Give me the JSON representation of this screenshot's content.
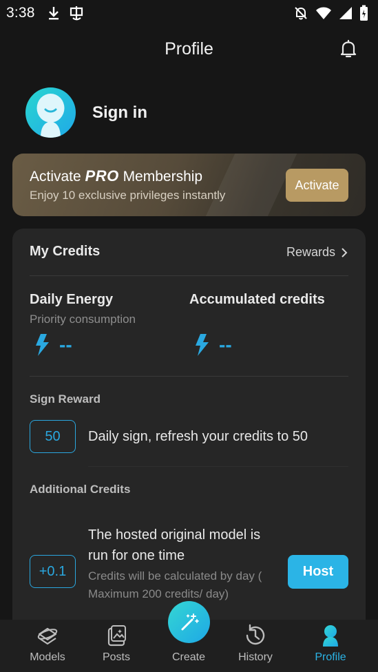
{
  "status_bar": {
    "time": "3:38",
    "icons": [
      "download-icon",
      "app-notification-icon",
      "bell-off-icon",
      "wifi-icon",
      "signal-icon",
      "battery-icon"
    ]
  },
  "header": {
    "title": "Profile"
  },
  "profile": {
    "signin_label": "Sign in"
  },
  "pro_banner": {
    "title_prefix": "Activate ",
    "title_pro": "PRO",
    "title_suffix": " Membership",
    "subtitle": "Enjoy 10 exclusive privileges instantly",
    "button_label": "Activate"
  },
  "credits": {
    "title": "My Credits",
    "rewards_label": "Rewards",
    "daily_energy": {
      "title": "Daily Energy",
      "subtitle": "Priority consumption",
      "value": "--"
    },
    "accumulated": {
      "title": "Accumulated credits",
      "value": "--"
    },
    "sign_reward": {
      "label": "Sign Reward",
      "badge": "50",
      "description": "Daily sign, refresh your credits to 50"
    },
    "additional": {
      "label": "Additional Credits",
      "badge": "+0.1",
      "title": "The hosted original model is run for one time",
      "description": "Credits will be calculated by day ( Maximum 200 credits/ day)",
      "button_label": "Host"
    }
  },
  "bottom_nav": {
    "items": [
      {
        "label": "Models",
        "icon": "models-icon"
      },
      {
        "label": "Posts",
        "icon": "posts-icon"
      },
      {
        "label": "Create",
        "icon": "magic-wand-icon"
      },
      {
        "label": "History",
        "icon": "history-icon"
      },
      {
        "label": "Profile",
        "icon": "profile-icon",
        "active": true
      }
    ]
  },
  "colors": {
    "accent": "#2bb4e6",
    "gold": "#b89a63",
    "background": "#161616",
    "card": "#262626"
  }
}
